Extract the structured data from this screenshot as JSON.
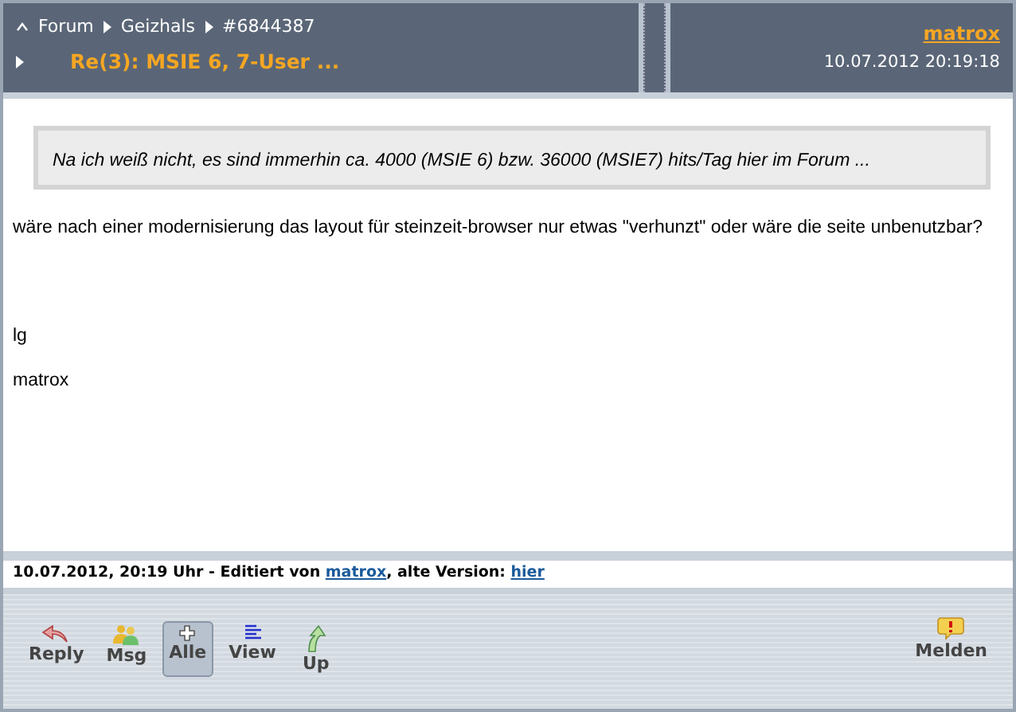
{
  "breadcrumb": [
    {
      "label": "Forum"
    },
    {
      "label": "Geizhals"
    },
    {
      "label": "#6844387"
    }
  ],
  "title": "Re(3): MSIE 6, 7-User ...",
  "author": "matrox",
  "datetime": "10.07.2012 20:19:18",
  "quote": "Na ich weiß nicht, es sind immerhin ca. 4000 (MSIE 6) bzw. 36000 (MSIE7) hits/Tag hier im Forum ...",
  "paragraphs": [
    "wäre nach einer modernisierung das layout für steinzeit-browser nur etwas \"verhunzt\" oder wäre die seite unbenutzbar?",
    "lg",
    "matrox"
  ],
  "edit_note": {
    "text": "10.07.2012, 20:19 Uhr - Editiert von",
    "user": "matrox",
    "middle": ", alte Version:",
    "link": "hier"
  },
  "toolbar": [
    {
      "kind": "reply",
      "label": "Reply",
      "selected": false
    },
    {
      "kind": "msg",
      "label": "Msg",
      "selected": false
    },
    {
      "kind": "all",
      "label": "Alle",
      "selected": true
    },
    {
      "kind": "view",
      "label": "View",
      "selected": false
    },
    {
      "kind": "up",
      "label": "Up",
      "selected": false
    }
  ],
  "report_button": {
    "label": "Melden"
  }
}
